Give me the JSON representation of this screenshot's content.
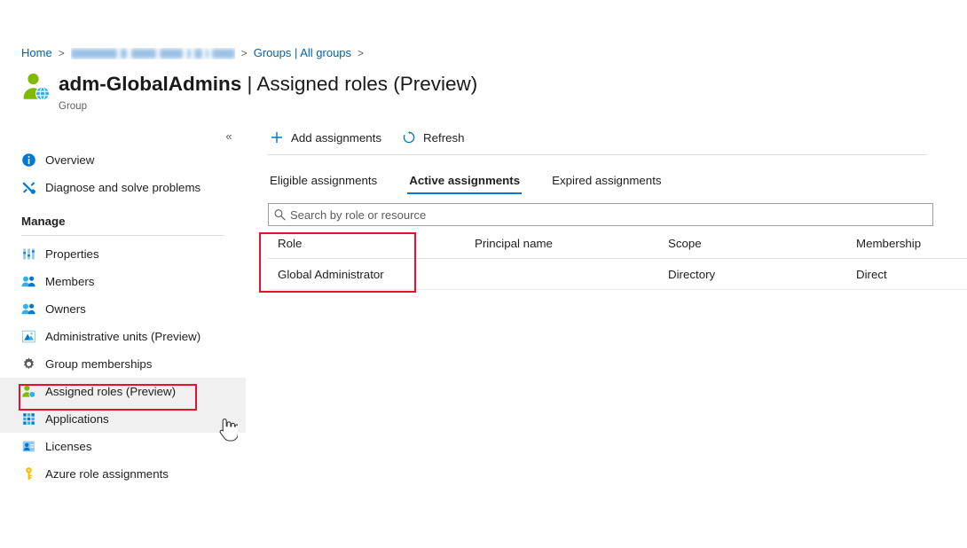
{
  "breadcrumb": {
    "items": [
      {
        "label": "Home",
        "redacted": false
      },
      {
        "label": "",
        "redacted": true
      },
      {
        "label": "Groups | All groups",
        "redacted": false
      }
    ],
    "separator": ">"
  },
  "header": {
    "title_main": "adm-GlobalAdmins",
    "title_rest": " | Assigned roles (Preview)",
    "subtitle": "Group",
    "icon": "group-user-icon"
  },
  "sidebar": {
    "collapse_label": "«",
    "top_items": [
      {
        "label": "Overview",
        "icon": "info-circle-icon"
      },
      {
        "label": "Diagnose and solve problems",
        "icon": "wrench-cross-icon"
      }
    ],
    "section_label": "Manage",
    "manage_items": [
      {
        "label": "Properties",
        "icon": "sliders-icon",
        "highlighted": false
      },
      {
        "label": "Members",
        "icon": "people-icon",
        "highlighted": false
      },
      {
        "label": "Owners",
        "icon": "people-icon",
        "highlighted": false
      },
      {
        "label": "Administrative units (Preview)",
        "icon": "building-icon",
        "highlighted": false
      },
      {
        "label": "Group memberships",
        "icon": "gear-icon",
        "highlighted": false
      },
      {
        "label": "Assigned roles (Preview)",
        "icon": "assigned-roles-icon",
        "highlighted": true
      },
      {
        "label": "Applications",
        "icon": "grid-apps-icon",
        "highlighted": true
      },
      {
        "label": "Licenses",
        "icon": "license-person-icon",
        "highlighted": false
      },
      {
        "label": "Azure role assignments",
        "icon": "key-icon",
        "highlighted": false
      }
    ]
  },
  "toolbar": {
    "add_label": "Add assignments",
    "add_icon": "plus-icon",
    "refresh_label": "Refresh",
    "refresh_icon": "refresh-icon"
  },
  "tabs": [
    {
      "label": "Eligible assignments",
      "active": false
    },
    {
      "label": "Active assignments",
      "active": true
    },
    {
      "label": "Expired assignments",
      "active": false
    }
  ],
  "search": {
    "placeholder": "Search by role or resource",
    "value": "",
    "icon": "search-icon"
  },
  "table": {
    "columns": [
      "Role",
      "Principal name",
      "Scope",
      "Membership"
    ],
    "rows": [
      {
        "role": "Global Administrator",
        "principal_name": "",
        "scope": "Directory",
        "membership": "Direct"
      }
    ]
  },
  "annotations": {
    "accent_color": "#0078d4",
    "highlight_color": "#e8112d",
    "boxes": [
      {
        "name": "assigned-roles-nav-highlight"
      },
      {
        "name": "role-column-highlight"
      }
    ]
  },
  "cursor": {
    "type": "pointer-hand"
  }
}
